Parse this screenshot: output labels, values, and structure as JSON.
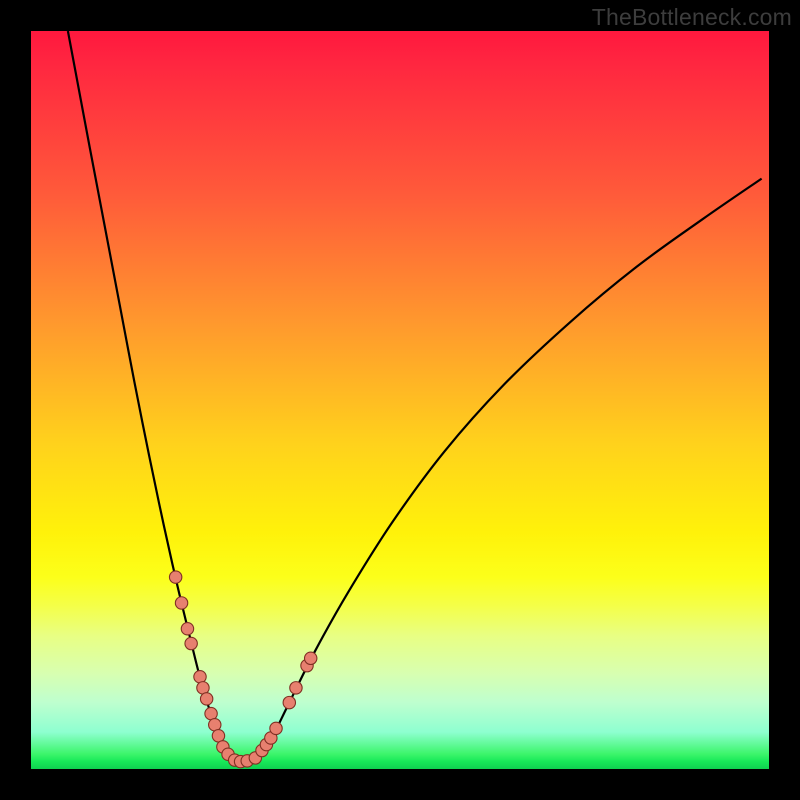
{
  "watermark": "TheBottleneck.com",
  "colors": {
    "frame": "#000000",
    "curve": "#000000",
    "dot_fill": "#e7806f",
    "dot_stroke": "#803023",
    "gradient_top": "#ff183e",
    "gradient_bottom": "#0fd050"
  },
  "chart_data": {
    "type": "line",
    "title": "",
    "xlabel": "",
    "ylabel": "",
    "xlim": [
      0,
      100
    ],
    "ylim": [
      0,
      100
    ],
    "grid": false,
    "legend": false,
    "note": "No axis ticks are shown; x/y are normalized 0-100 plot coordinates (origin bottom-left). y represents bottleneck/mismatch percentage (high=red, low=green).",
    "series": [
      {
        "name": "left-curve",
        "x": [
          5.0,
          6.5,
          8.0,
          10.0,
          12.0,
          14.0,
          16.0,
          18.0,
          19.8,
          21.5,
          23.0,
          24.2,
          25.2,
          26.0,
          26.7
        ],
        "y": [
          100.0,
          92.0,
          84.0,
          73.5,
          63.0,
          52.5,
          42.5,
          33.0,
          25.0,
          18.0,
          12.0,
          8.0,
          5.0,
          3.0,
          2.0
        ]
      },
      {
        "name": "floor",
        "x": [
          26.7,
          27.4,
          28.2,
          29.0,
          29.9,
          30.9
        ],
        "y": [
          2.0,
          1.2,
          1.0,
          1.0,
          1.2,
          1.8
        ]
      },
      {
        "name": "right-curve",
        "x": [
          30.9,
          32.5,
          35.0,
          38.5,
          43.0,
          49.0,
          56.0,
          64.0,
          73.0,
          82.0,
          91.0,
          99.0
        ],
        "y": [
          1.8,
          4.0,
          9.0,
          16.0,
          24.0,
          33.5,
          43.0,
          52.0,
          60.5,
          68.0,
          74.5,
          80.0
        ]
      }
    ],
    "points": [
      {
        "name": "left-cluster",
        "series_ref": "left-curve",
        "x": [
          19.6,
          20.4,
          21.2,
          21.7,
          22.9,
          23.3,
          23.8,
          24.4,
          24.9,
          25.4,
          26.0
        ],
        "y": [
          26.0,
          22.5,
          19.0,
          17.0,
          12.5,
          11.0,
          9.5,
          7.5,
          6.0,
          4.5,
          3.0
        ]
      },
      {
        "name": "bottom-cluster",
        "series_ref": "floor",
        "x": [
          26.7,
          27.6,
          28.4,
          29.3,
          30.4
        ],
        "y": [
          2.0,
          1.2,
          1.0,
          1.1,
          1.5
        ]
      },
      {
        "name": "right-cluster",
        "series_ref": "right-curve",
        "x": [
          31.3,
          31.9,
          32.5,
          33.2,
          35.0,
          35.9,
          37.4,
          37.9
        ],
        "y": [
          2.5,
          3.3,
          4.2,
          5.5,
          9.0,
          11.0,
          14.0,
          15.0
        ]
      }
    ]
  }
}
